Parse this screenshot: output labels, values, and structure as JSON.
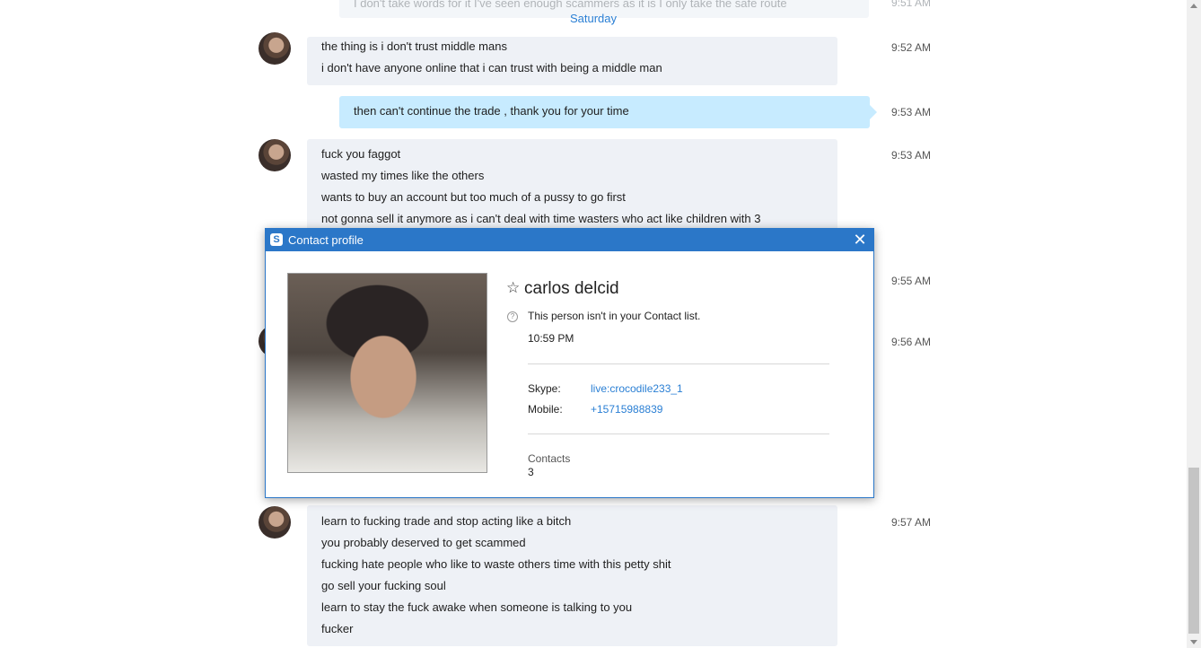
{
  "chat": {
    "ghost_text": "I don't take words for it I've seen enough scammers as it is I only take the safe route",
    "ghost_time": "9:51 AM",
    "date_separator": "Saturday",
    "messages": [
      {
        "time": "9:52 AM",
        "lines": [
          "the thing is i don't trust middle mans",
          "i don't have anyone online that i can trust with being a middle man"
        ]
      },
      {
        "time": "9:53 AM",
        "lines": [
          "then can't continue the trade , thank you for your time"
        ]
      },
      {
        "time": "9:53 AM",
        "lines": [
          "fuck you faggot",
          "wasted my times like the others",
          "wants to buy an account but too much of a pussy to go first",
          "not gonna sell it anymore as i can't deal with time wasters who act like children with 3"
        ]
      },
      {
        "time": "9:55 AM",
        "lines": []
      },
      {
        "time": "9:56 AM",
        "lines": []
      },
      {
        "time": "9:57 AM",
        "lines": [
          "learn to fucking trade and stop acting like a bitch",
          "you probably deserved to get scammed",
          "fucking hate people who like to waste others time with this petty shit",
          "go sell your fucking soul",
          "learn to stay the fuck awake when someone is talking to you",
          "fucker"
        ]
      }
    ]
  },
  "dialog": {
    "title": "Contact profile",
    "logo_letter": "S",
    "name": "carlos delcid",
    "status": "This person isn't in your Contact list.",
    "local_time": "10:59 PM",
    "skype_label": "Skype:",
    "skype_value": "live:crocodile233_1",
    "mobile_label": "Mobile:",
    "mobile_value": "+15715988839",
    "contacts_label": "Contacts",
    "contacts_count": "3"
  },
  "colors": {
    "accent": "#2b77c8",
    "link": "#2a7fd4",
    "incoming_bubble": "#eef1f6",
    "outgoing_bubble": "#c7ebff"
  }
}
